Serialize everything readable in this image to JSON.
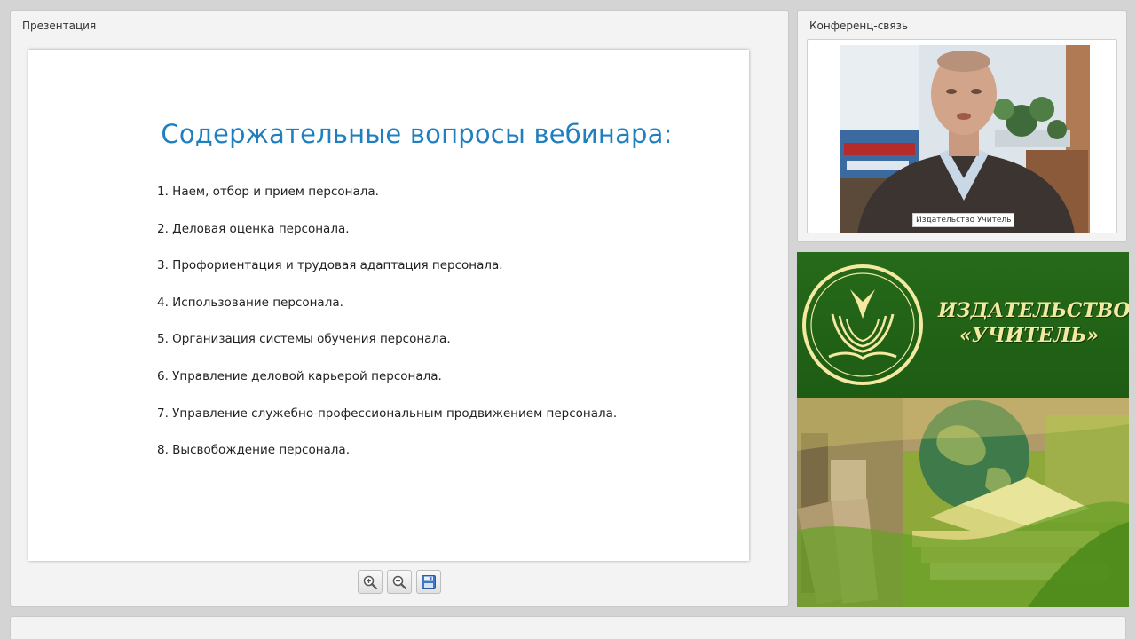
{
  "presentation": {
    "panel_title": "Презентация",
    "slide": {
      "title": "Содержательные вопросы вебинара:",
      "items": [
        "1. Наем, отбор и прием персонала.",
        "2. Деловая оценка персонала.",
        "3. Профориентация и трудовая адаптация персонала.",
        "4. Использование персонала.",
        "5. Организация системы обучения персонала.",
        "6. Управление деловой карьерой персонала.",
        "7. Управление служебно-профессиональным продвижением персонала.",
        "8. Высвобождение персонала."
      ]
    },
    "toolbar": {
      "zoom_in_icon": "zoom-in-icon",
      "zoom_out_icon": "zoom-out-icon",
      "save_icon": "floppy-disk-icon"
    }
  },
  "conference": {
    "panel_title": "Конференц-связь",
    "video_caption": "Издательство Учитель"
  },
  "brand": {
    "line1": "ИЗДАТЕЛЬСТВО",
    "line2": "«УЧИТЕЛЬ»",
    "colors": {
      "green": "#266a1a",
      "gold": "#f4e9a0"
    }
  },
  "colors": {
    "slide_title": "#1f7fbf"
  }
}
